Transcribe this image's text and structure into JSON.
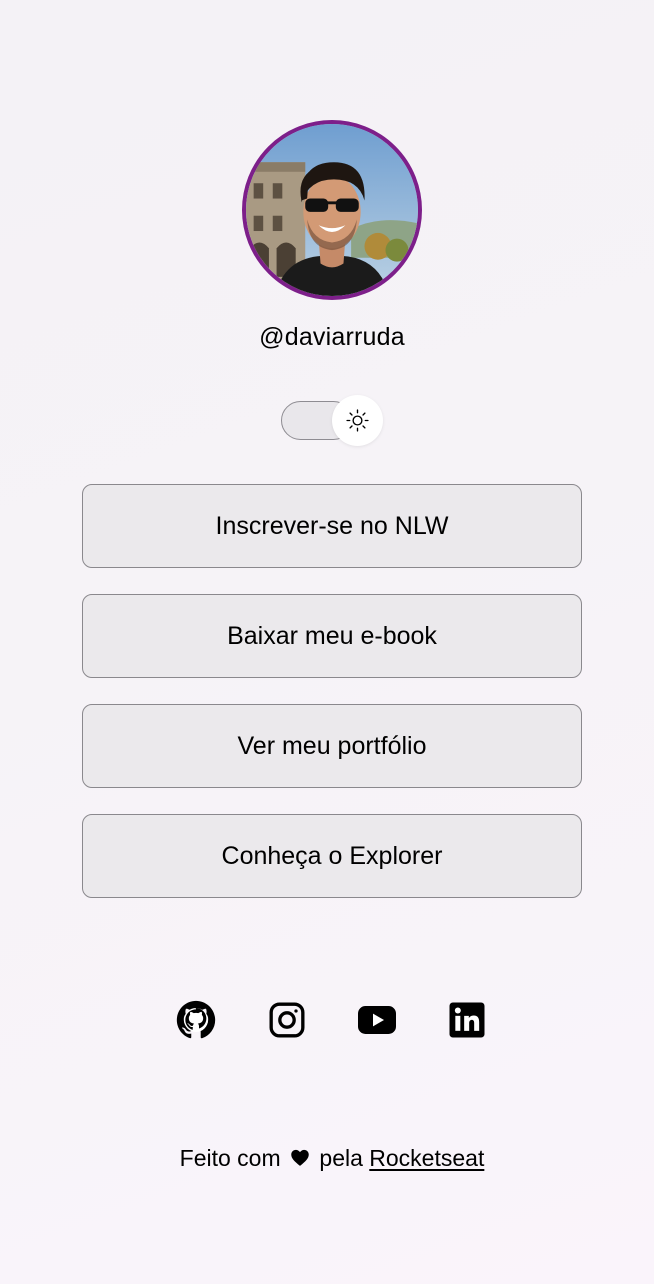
{
  "profile": {
    "username": "@daviarruda",
    "avatar_border_color": "#7d1f8a",
    "avatar_icon": "profile-photo"
  },
  "theme_switch": {
    "icon": "sun-icon",
    "mode": "light"
  },
  "links": [
    {
      "label": "Inscrever-se no NLW"
    },
    {
      "label": "Baixar meu e-book"
    },
    {
      "label": "Ver meu portfólio"
    },
    {
      "label": "Conheça o Explorer"
    }
  ],
  "social": [
    {
      "icon": "github-icon"
    },
    {
      "icon": "instagram-icon"
    },
    {
      "icon": "youtube-icon"
    },
    {
      "icon": "linkedin-icon"
    }
  ],
  "footer": {
    "text_before": "Feito com",
    "heart_icon": "heart-icon",
    "text_after": "pela",
    "link_label": "Rocketseat"
  },
  "colors": {
    "button_background": "#ebe9ec",
    "button_border": "#8a888d",
    "text": "#000000"
  }
}
